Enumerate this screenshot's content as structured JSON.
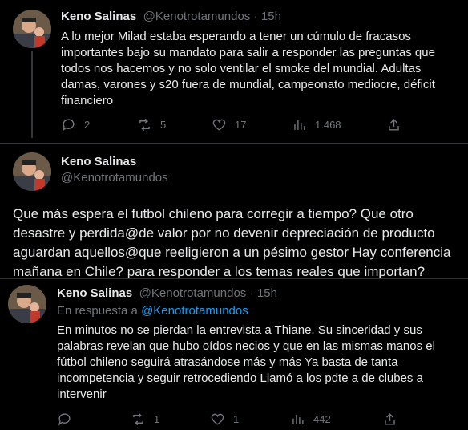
{
  "tweet1": {
    "name": "Keno Salinas",
    "handle": "@Kenotrotamundos",
    "time": "· 15h",
    "lines": [
      "A lo mejor Milad estaba esperando a tener un cúmulo de fracasos",
      "importantes bajo su mandato para salir a responder las preguntas que",
      "todos nos hacemos y no solo ventilar el smoke del mundial. Adultas",
      "damas, varones y s20 fuera de mundial, campeonato mediocre, déficit",
      "financiero"
    ],
    "replies": "2",
    "retweets": "5",
    "likes": "17",
    "views": "1.468"
  },
  "tweet2": {
    "name": "Keno Salinas",
    "handle": "@Kenotrotamundos",
    "lines": [
      "Que más espera el futbol chileno para corregir a tiempo? Que otro",
      "desastre y perdida@de valor por no devenir depreciación de producto",
      "aguardan aquellos@que reeligieron a un pésimo gestor Hay conferencia",
      "mañana en Chile? para responder a los temas reales que importan?"
    ]
  },
  "tweet3": {
    "name": "Keno Salinas",
    "handle": "@Kenotrotamundos",
    "time": "· 15h",
    "reply_prefix": "En respuesta a",
    "reply_to": "@Kenotrotamundos",
    "lines": [
      "En minutos no se pierdan la entrevista a Thiane. Su sinceridad y sus",
      "palabras revelan que hubo oídos necios y que en las mismas manos el",
      "fútbol chileno seguirá atrasándose más y más Ya basta de tanta",
      "incompetencia y seguir retrocediendo Llamó a los pdte a de clubes a",
      "intervenir"
    ],
    "retweets": "1",
    "likes": "1",
    "views": "442"
  },
  "colors": {
    "accent": "#1d9bf0",
    "muted": "#71767b",
    "text": "#e7e9ea",
    "background": "#000000"
  },
  "icons": [
    "reply-icon",
    "retweet-icon",
    "like-icon",
    "views-icon",
    "share-icon"
  ]
}
